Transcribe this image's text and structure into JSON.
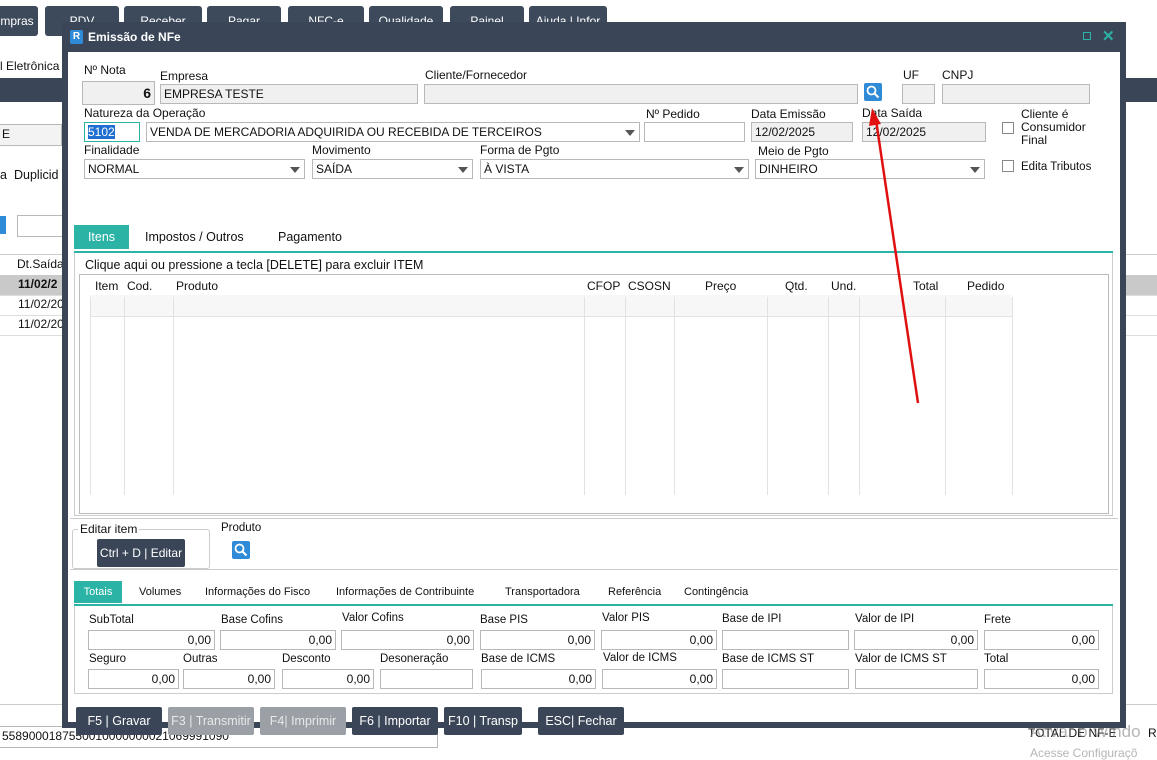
{
  "background": {
    "top_buttons": [
      "mpras",
      "PDV",
      "Receber",
      "Pagar",
      "NFC-e",
      "Qualidade",
      "Painel",
      "Ajuda | Infor"
    ],
    "menu_text": "l Eletrônica",
    "side_label_e": "E",
    "tab_a": "a",
    "tab_duplicid": "Duplicid",
    "col_dt_saida": "Dt.Saída",
    "rows": [
      "11/02/2",
      "11/02/20",
      "11/02/20"
    ],
    "footer_key": "5589000187550010000000021069991090",
    "footer_total": "TOTAL DE NF-E",
    "footer_r": "R",
    "footer_watermark1": "Ativar o Windo",
    "footer_watermark2": "Acesse Configuraçõ"
  },
  "modal": {
    "title": "Emissão de NFe",
    "app_icon": "R",
    "labels": {
      "nota": "Nº Nota",
      "empresa": "Empresa",
      "cliente": "Cliente/Fornecedor",
      "uf": "UF",
      "cnpj": "CNPJ",
      "natureza": "Natureza da Operação",
      "pedido": "Nº Pedido",
      "data_emissao": "Data Emissão",
      "data_saida": "Data Saída",
      "cliente_final": "Cliente é Consumidor Final",
      "finalidade": "Finalidade",
      "movimento": "Movimento",
      "forma_pgto": "Forma de Pgto",
      "meio_pgto": "Meio de Pgto",
      "edita_tributos": "Edita Tributos"
    },
    "values": {
      "nota": "6",
      "empresa": "EMPRESA TESTE",
      "cliente": "",
      "uf": "",
      "cnpj": "",
      "natureza_code": "5102",
      "natureza_desc": "VENDA DE MERCADORIA ADQUIRIDA OU RECEBIDA DE TERCEIROS",
      "pedido": "",
      "data_emissao": "12/02/2025",
      "data_saida": "12/02/2025",
      "finalidade": "NORMAL",
      "movimento": "SAÍDA",
      "forma_pgto": "À VISTA",
      "meio_pgto": "DINHEIRO"
    },
    "tabs_top": [
      "Itens",
      "Impostos  / Outros",
      "Pagamento"
    ],
    "items_hint": "Clique aqui ou pressione a tecla  [DELETE] para excluir ITEM",
    "grid_headers": [
      "Item",
      "Cod.",
      "Produto",
      "CFOP",
      "CSOSN",
      "Preço",
      "Qtd.",
      "Und.",
      "Total",
      "Pedido"
    ],
    "editar_item_label": "Editar item",
    "editar_button": "Ctrl + D | Editar",
    "produto_label": "Produto",
    "tabs_bottom": [
      "Totais",
      "Volumes",
      "Informações do Fisco",
      "Informações de Contribuinte",
      "Transportadora",
      "Referência",
      "Contingência"
    ],
    "totals_row1": [
      {
        "label": "SubTotal",
        "value": "0,00"
      },
      {
        "label": "Base Cofins",
        "value": "0,00"
      },
      {
        "label": "Valor Cofins",
        "value": "0,00"
      },
      {
        "label": "Base PIS",
        "value": "0,00"
      },
      {
        "label": "Valor PIS",
        "value": "0,00"
      },
      {
        "label": "Base de IPI",
        "value": ""
      },
      {
        "label": "Valor de IPI",
        "value": "0,00"
      },
      {
        "label": "Frete",
        "value": "0,00"
      }
    ],
    "totals_row2": [
      {
        "label": "Seguro",
        "value": "0,00"
      },
      {
        "label": "Outras",
        "value": "0,00"
      },
      {
        "label": "Desconto",
        "value": "0,00"
      },
      {
        "label": "Desoneração",
        "value": ""
      },
      {
        "label": "Base de ICMS",
        "value": "0,00"
      },
      {
        "label": "Valor de ICMS",
        "value": "0,00"
      },
      {
        "label": "Base de ICMS ST",
        "value": ""
      },
      {
        "label": "Valor de ICMS ST",
        "value": ""
      },
      {
        "label": "Total",
        "value": "0,00"
      }
    ],
    "actions": [
      "F5 | Gravar",
      "F3 | Transmitir",
      "F4| Imprimir",
      "F6 | Importar",
      "F10 | Transp",
      "ESC| Fechar"
    ]
  },
  "colors": {
    "header": "#3a4658",
    "accent": "#2bb3a6",
    "arrow": "#e01010"
  }
}
